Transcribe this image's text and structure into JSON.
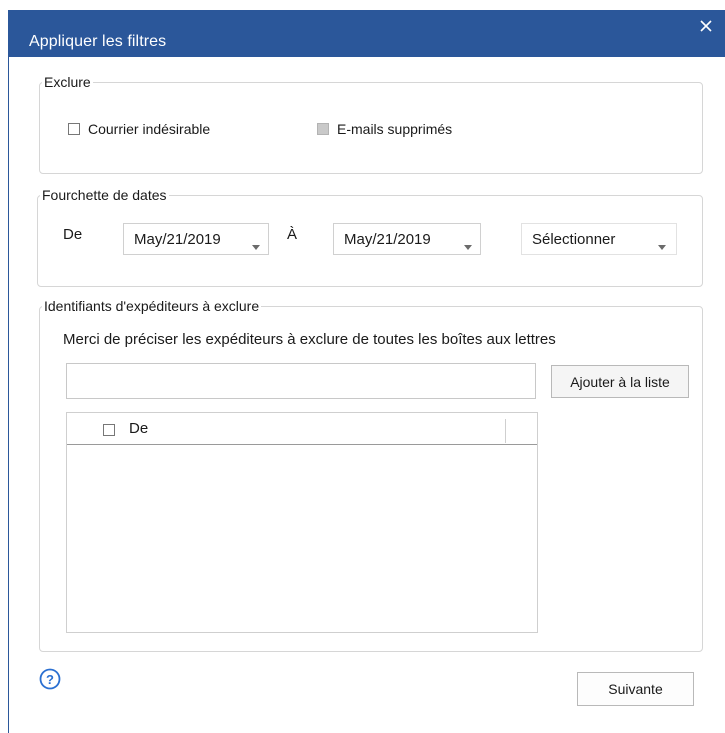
{
  "dialog": {
    "title": "Appliquer les filtres",
    "accent_color": "#2b579a",
    "close_icon": "close-icon"
  },
  "exclude": {
    "legend": "Exclure",
    "junk_mail": {
      "label": "Courrier indésirable",
      "checked": false,
      "enabled": true
    },
    "deleted_emails": {
      "label": "E-mails supprimés",
      "checked": false,
      "enabled": false
    }
  },
  "date_range": {
    "legend": "Fourchette de dates",
    "from_label": "De",
    "from_value": "May/21/2019",
    "to_label": "À",
    "to_value": "May/21/2019",
    "preset_value": "Sélectionner"
  },
  "senders": {
    "legend": "Identifiants d'expéditeurs à exclure",
    "instruction": "Merci de préciser les expéditeurs à exclure de toutes les boîtes aux lettres",
    "input_value": "",
    "add_button": "Ajouter à la liste",
    "list": {
      "columns": [
        "De"
      ],
      "rows": []
    }
  },
  "footer": {
    "help_icon": "help-icon",
    "next_button": "Suivante"
  }
}
